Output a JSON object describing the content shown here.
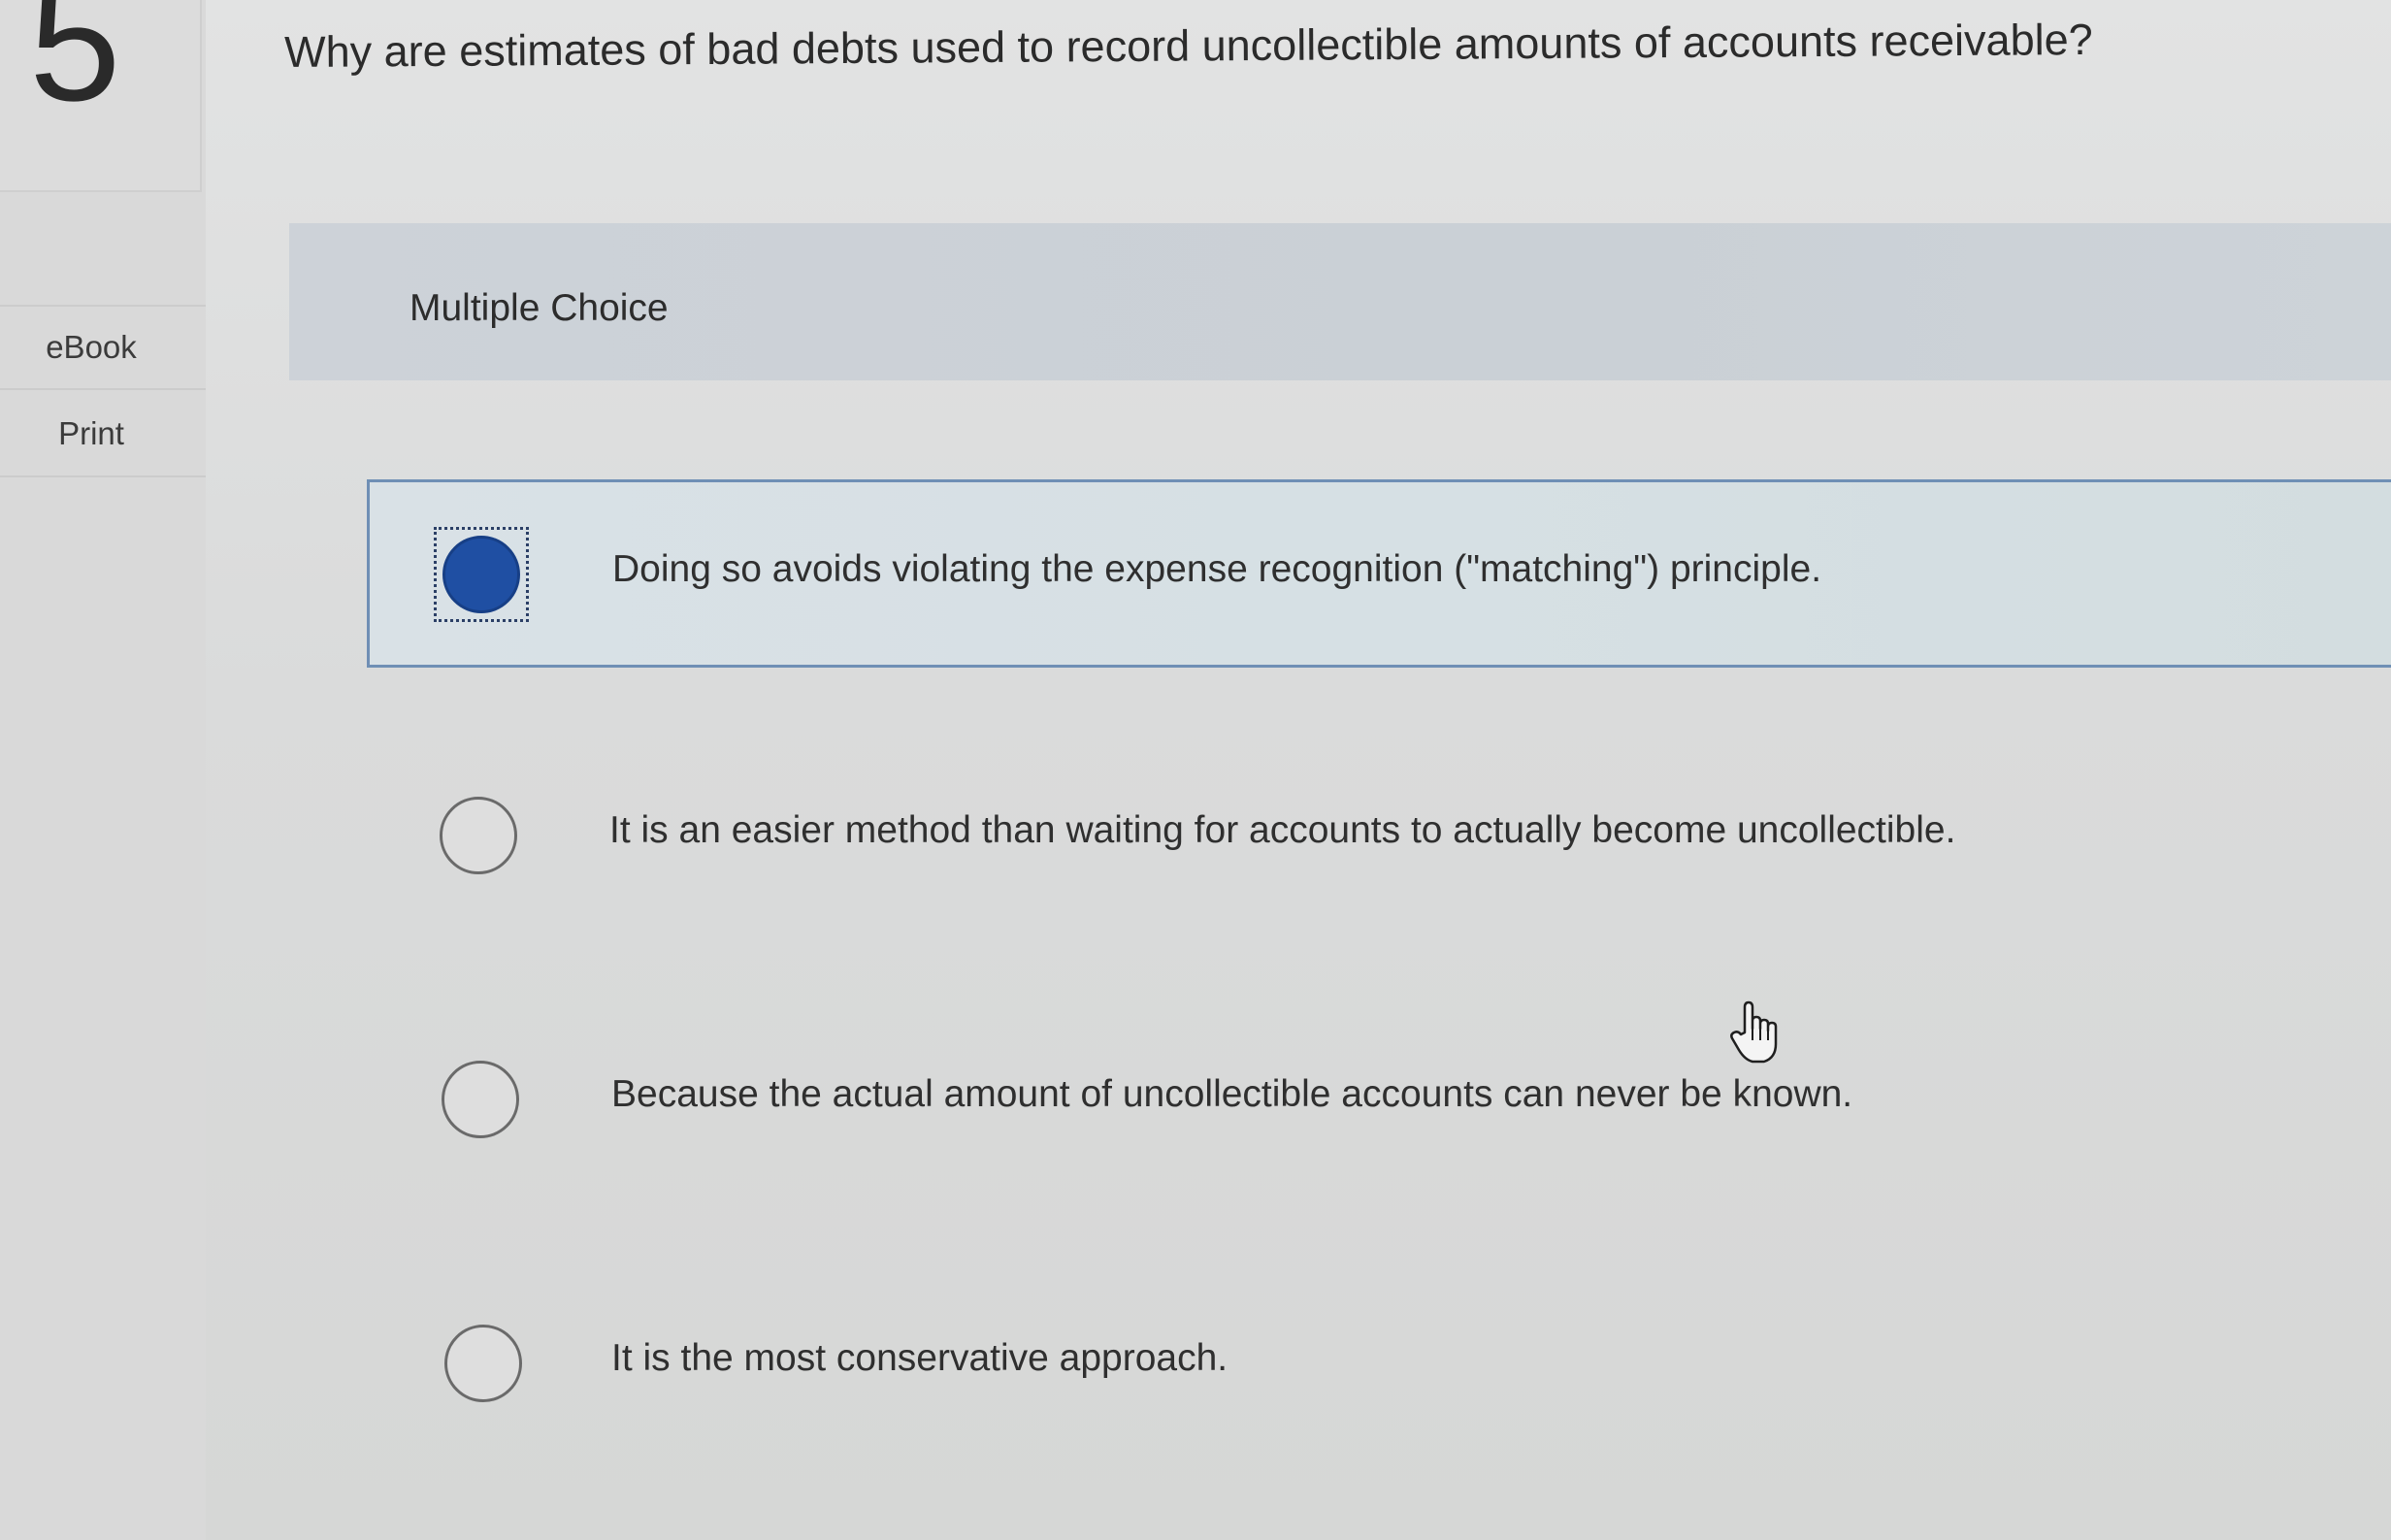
{
  "question": {
    "number": "5",
    "text": "Why are estimates of bad debts used to record uncollectible amounts of accounts receivable?"
  },
  "left_rail": {
    "items": [
      {
        "label": "eBook"
      },
      {
        "label": "Print"
      }
    ]
  },
  "mc": {
    "label": "Multiple Choice",
    "selected_index": 0,
    "options": [
      {
        "label": "Doing so avoids violating the expense recognition (\"matching\") principle."
      },
      {
        "label": "It is an easier method than waiting for accounts to actually become uncollectible."
      },
      {
        "label": "Because the actual amount of uncollectible accounts can never be known."
      },
      {
        "label": "It is the most conservative approach."
      }
    ]
  },
  "colors": {
    "selected_radio": "#1f4fa3",
    "selected_border": "#6f8fb5",
    "band": "#cdd2d8"
  },
  "icons": {
    "cursor": "hand-pointer-icon"
  }
}
